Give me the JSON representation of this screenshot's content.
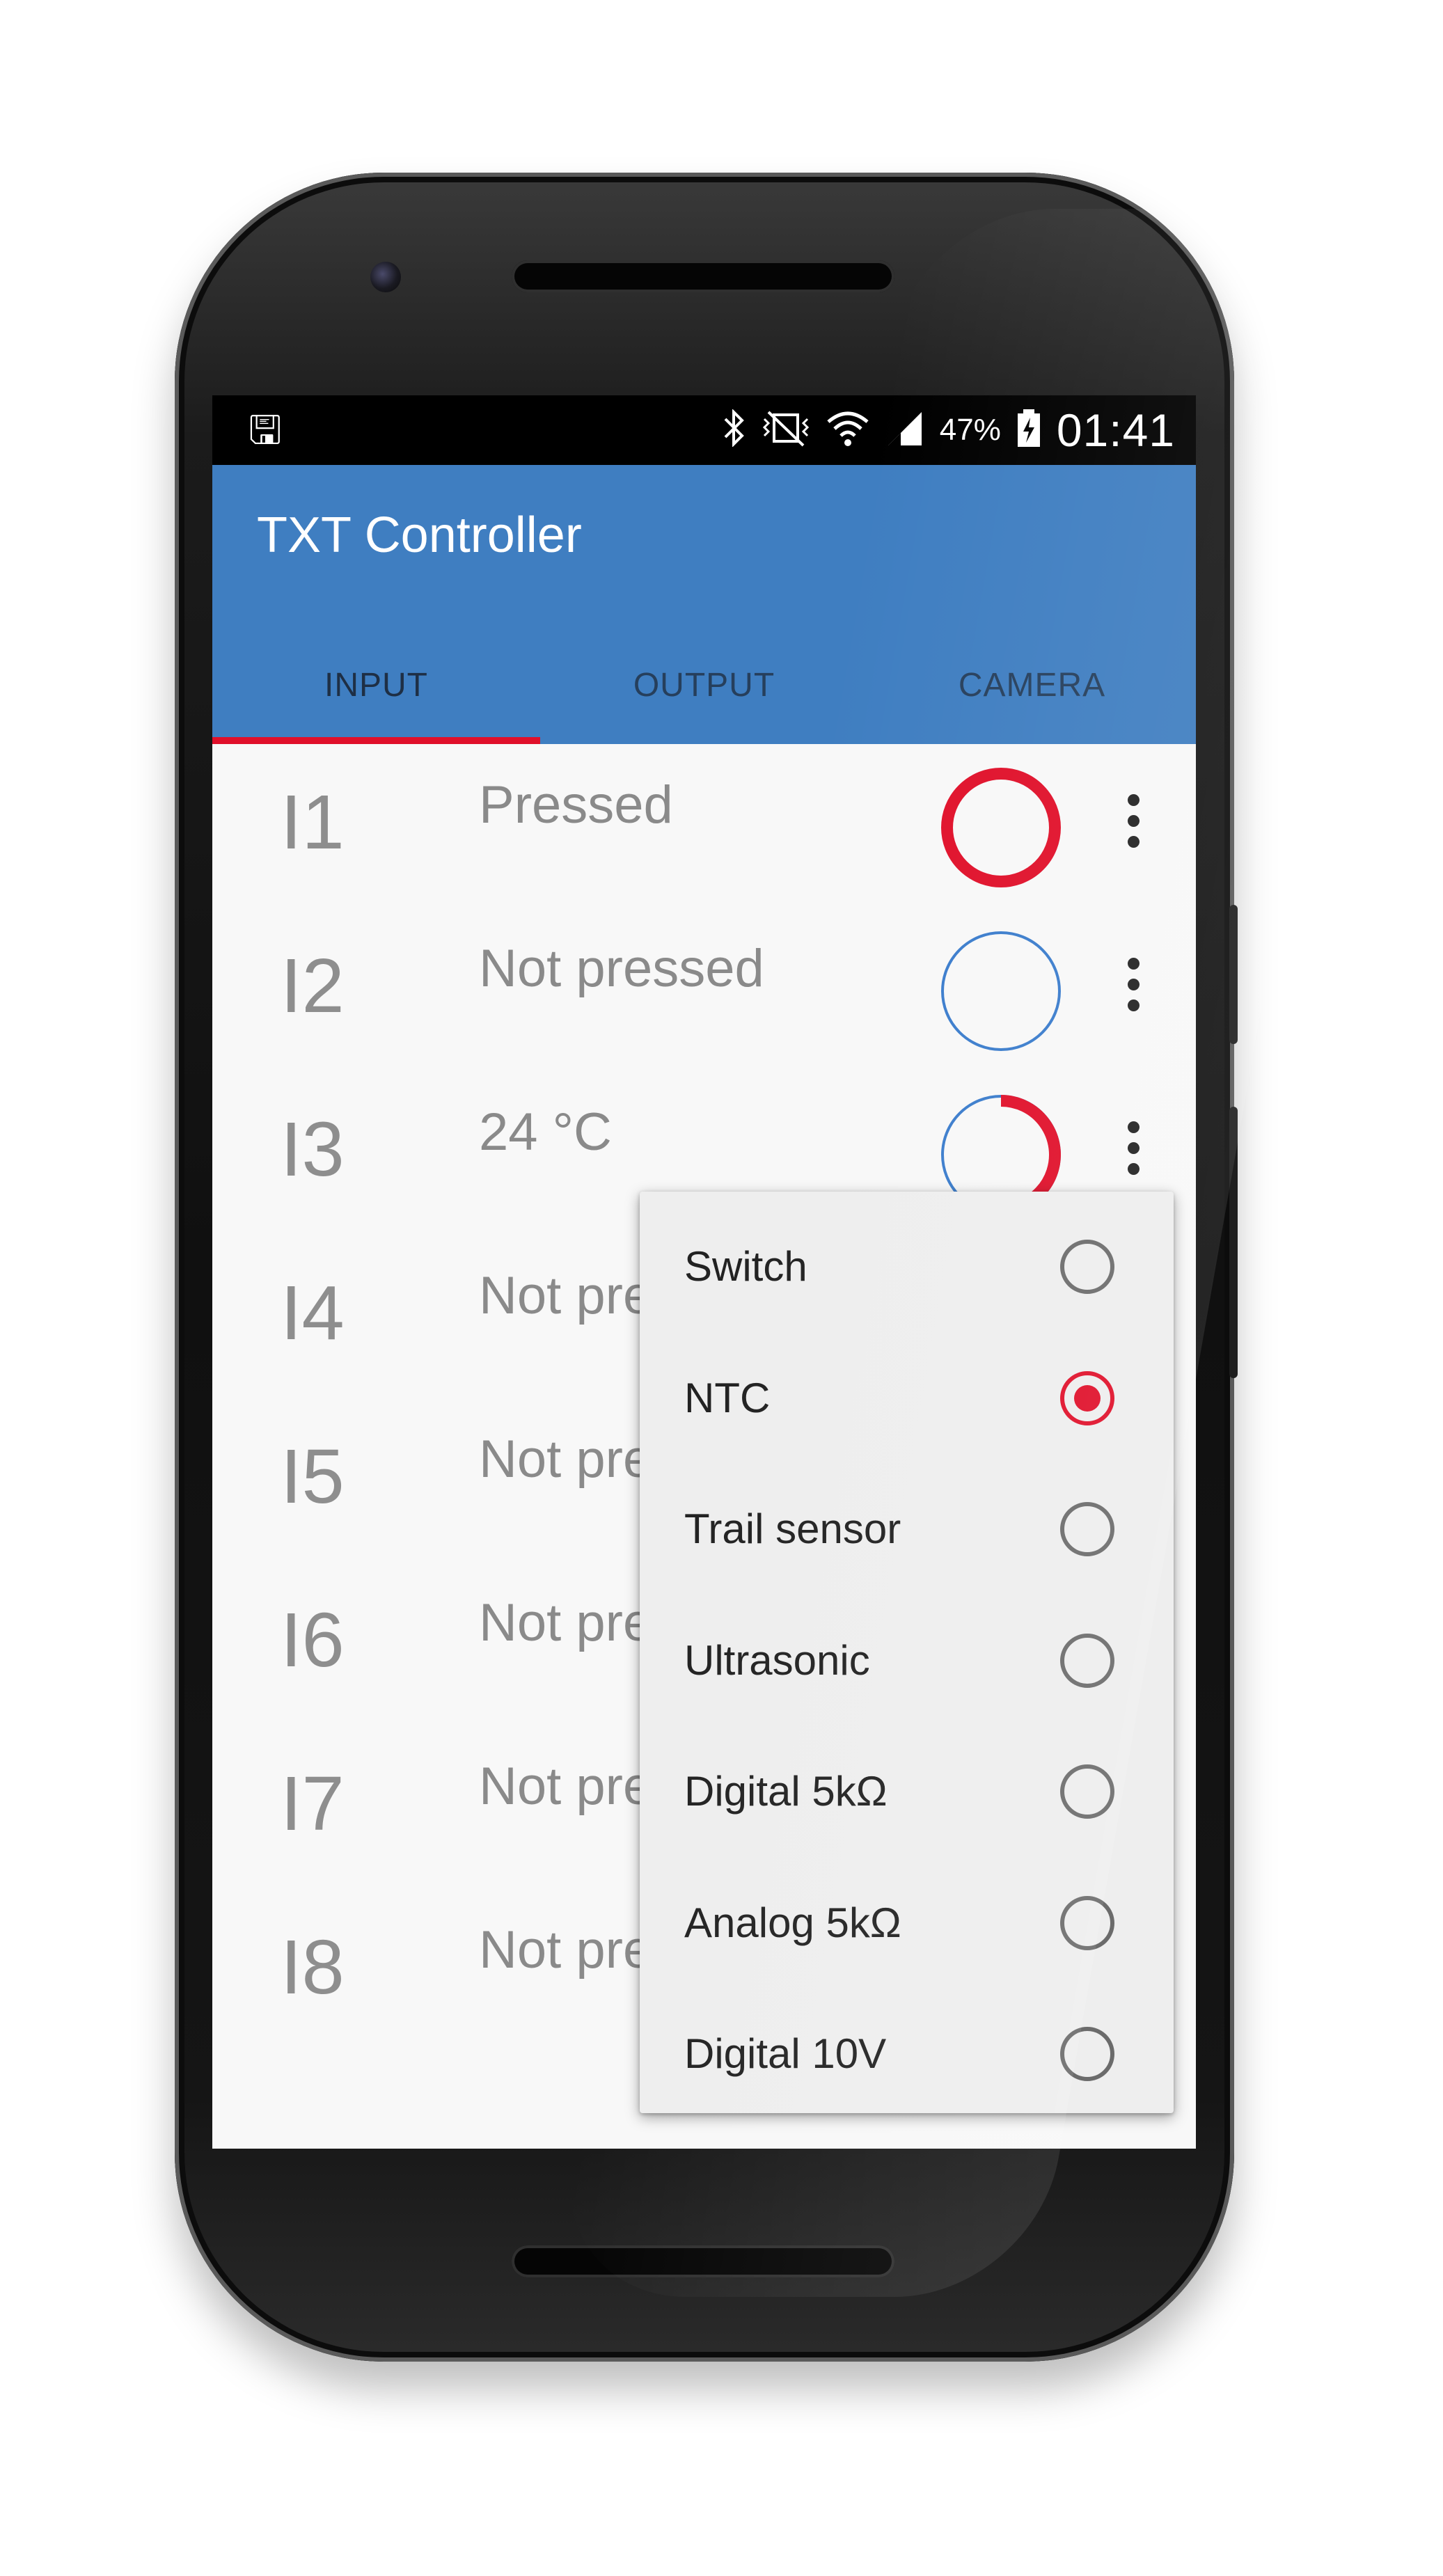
{
  "status_bar": {
    "usb_icon": "usb-icon",
    "icons": [
      "bluetooth-icon",
      "vibrate-icon",
      "wifi-icon",
      "signal-icon"
    ],
    "battery_pct": "47%",
    "time": "01:41"
  },
  "app": {
    "title": "TXT Controller"
  },
  "tabs": [
    {
      "label": "INPUT",
      "active": true
    },
    {
      "label": "OUTPUT",
      "active": false
    },
    {
      "label": "CAMERA",
      "active": false
    }
  ],
  "inputs": [
    {
      "id": "I1",
      "value": "Pressed",
      "indicator": "pressed"
    },
    {
      "id": "I2",
      "value": "Not pressed",
      "indicator": "open"
    },
    {
      "id": "I3",
      "value": "24 °C",
      "indicator": "gauge",
      "gauge_fraction": 0.6
    },
    {
      "id": "I4",
      "value": "Not pre",
      "indicator": "none"
    },
    {
      "id": "I5",
      "value": "Not pre",
      "indicator": "none"
    },
    {
      "id": "I6",
      "value": "Not pre",
      "indicator": "none"
    },
    {
      "id": "I7",
      "value": "Not pre",
      "indicator": "none"
    },
    {
      "id": "I8",
      "value": "Not pre",
      "indicator": "none"
    }
  ],
  "sensor_menu": {
    "options": [
      {
        "label": "Switch",
        "checked": false
      },
      {
        "label": "NTC",
        "checked": true
      },
      {
        "label": "Trail sensor",
        "checked": false
      },
      {
        "label": "Ultrasonic",
        "checked": false
      },
      {
        "label": "Digital 5kΩ",
        "checked": false
      },
      {
        "label": "Analog 5kΩ",
        "checked": false
      },
      {
        "label": "Digital 10V",
        "checked": false
      }
    ]
  },
  "colors": {
    "app_bar": "#3f7ec1",
    "accent": "#e0102a",
    "ring_blue": "#3a7ccc"
  }
}
